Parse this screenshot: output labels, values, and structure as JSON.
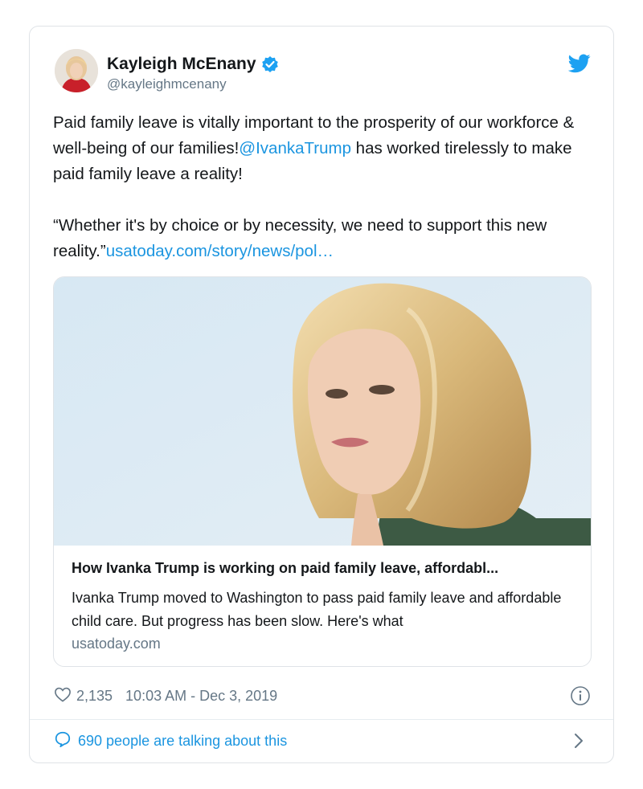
{
  "tweet": {
    "author_name": "Kayleigh McEnany",
    "author_handle": "@kayleighmcenany",
    "text_line1_a": "Paid family leave is vitally important to the prosperity of our workforce & well-being of our families!",
    "mention": "@IvankaTrump",
    "text_line1_b": " has worked tirelessly to make paid family leave a reality!",
    "quote_text": "“Whether it's by choice or by necessity, we need to support this new reality.”",
    "quote_link": "usatoday.com/story/news/pol…"
  },
  "preview": {
    "title": "How Ivanka Trump is working on paid family leave, affordabl...",
    "description": "Ivanka Trump moved to Washington to pass paid family leave and affordable child care. But progress has been slow. Here's what",
    "domain": "usatoday.com"
  },
  "meta": {
    "likes": "2,135",
    "timestamp": "10:03 AM - Dec 3, 2019"
  },
  "footer": {
    "talking": "690 people are talking about this"
  },
  "icons": {
    "verified": "verified-badge-icon",
    "bird": "twitter-bird-icon",
    "heart": "heart-icon",
    "info": "info-icon",
    "comment": "comment-bubble-icon",
    "chevron": "chevron-right-icon"
  },
  "colors": {
    "link": "#1b95e0",
    "muted": "#657786",
    "text": "#14171a",
    "border": "#dfe3e7"
  }
}
